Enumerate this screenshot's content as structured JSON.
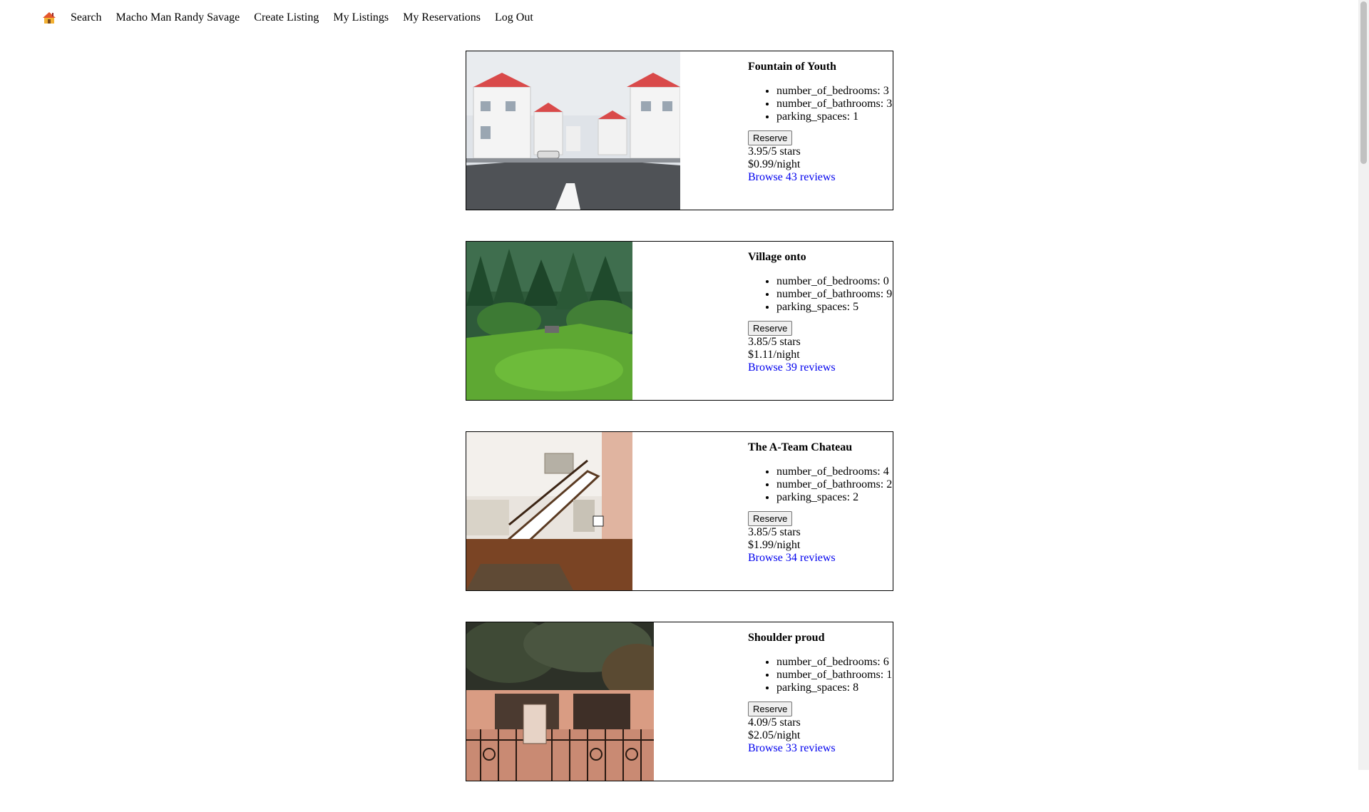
{
  "nav": {
    "home_icon": "house-icon",
    "links": [
      "Search",
      "Macho Man Randy Savage",
      "Create Listing",
      "My Listings",
      "My Reservations",
      "Log Out"
    ]
  },
  "listings": [
    {
      "title": "Fountain of Youth",
      "image": "street-of-white-houses-photo",
      "features": [
        "number_of_bedrooms: 3",
        "number_of_bathrooms: 3",
        "parking_spaces: 1"
      ],
      "reserve_label": "Reserve",
      "rating": "3.95/5 stars",
      "price": "$0.99/night",
      "reviews_link": "Browse 43 reviews"
    },
    {
      "title": "Village onto",
      "image": "green-valley-photo",
      "features": [
        "number_of_bedrooms: 0",
        "number_of_bathrooms: 9",
        "parking_spaces: 5"
      ],
      "reserve_label": "Reserve",
      "rating": "3.85/5 stars",
      "price": "$1.11/night",
      "reviews_link": "Browse 39 reviews"
    },
    {
      "title": "The A-Team Chateau",
      "image": "interior-staircase-photo",
      "features": [
        "number_of_bedrooms: 4",
        "number_of_bathrooms: 2",
        "parking_spaces: 2"
      ],
      "reserve_label": "Reserve",
      "rating": "3.85/5 stars",
      "price": "$1.99/night",
      "reviews_link": "Browse 34 reviews"
    },
    {
      "title": "Shoulder proud",
      "image": "ornate-gate-photo",
      "features": [
        "number_of_bedrooms: 6",
        "number_of_bathrooms: 1",
        "parking_spaces: 8"
      ],
      "reserve_label": "Reserve",
      "rating": "4.09/5 stars",
      "price": "$2.05/night",
      "reviews_link": "Browse 33 reviews"
    }
  ]
}
